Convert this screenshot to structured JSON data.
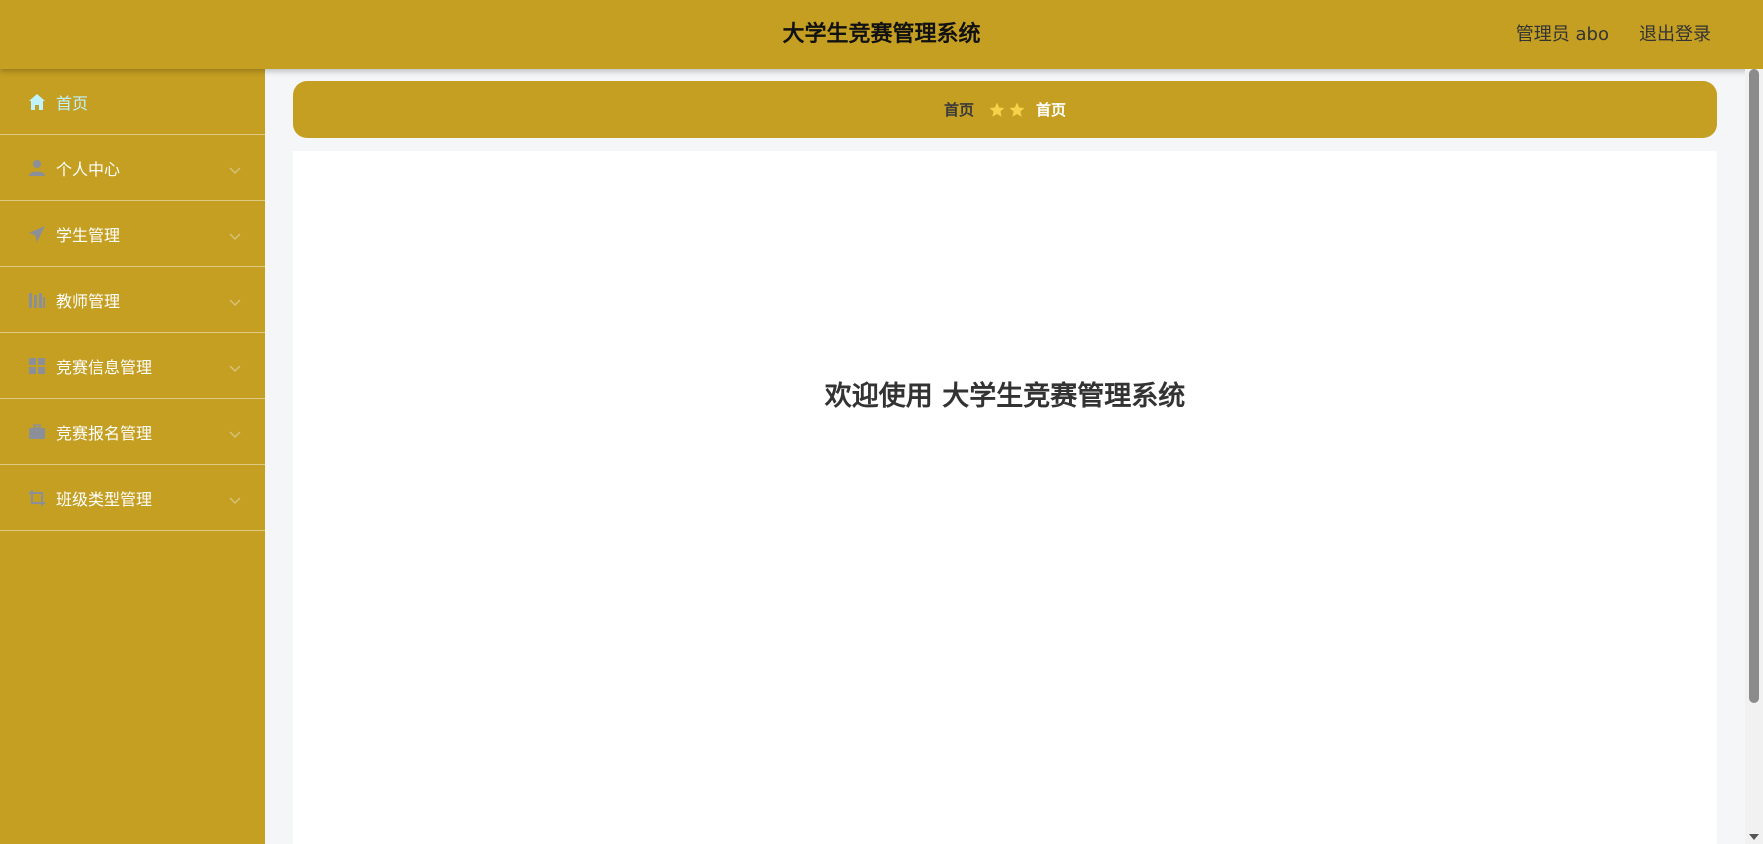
{
  "header": {
    "title": "大学生竞赛管理系统",
    "user": "管理员 abo",
    "logout": "退出登录"
  },
  "sidebar": {
    "items": [
      {
        "label": "首页",
        "icon": "home-icon",
        "active": true
      },
      {
        "label": "个人中心",
        "icon": "user-icon"
      },
      {
        "label": "学生管理",
        "icon": "send-icon"
      },
      {
        "label": "教师管理",
        "icon": "library-icon"
      },
      {
        "label": "竞赛信息管理",
        "icon": "grid-icon"
      },
      {
        "label": "竞赛报名管理",
        "icon": "briefcase-icon"
      },
      {
        "label": "班级类型管理",
        "icon": "crop-icon"
      }
    ]
  },
  "breadcrumb": {
    "home": "首页",
    "current": "首页",
    "separator_icon": "star-icon"
  },
  "main": {
    "welcome": "欢迎使用 大学生竞赛管理系统"
  },
  "colors": {
    "theme": "#c49f22",
    "active_text": "#bff3ff",
    "icon_gray": "#8a8f99",
    "star": "#f5d24a"
  }
}
